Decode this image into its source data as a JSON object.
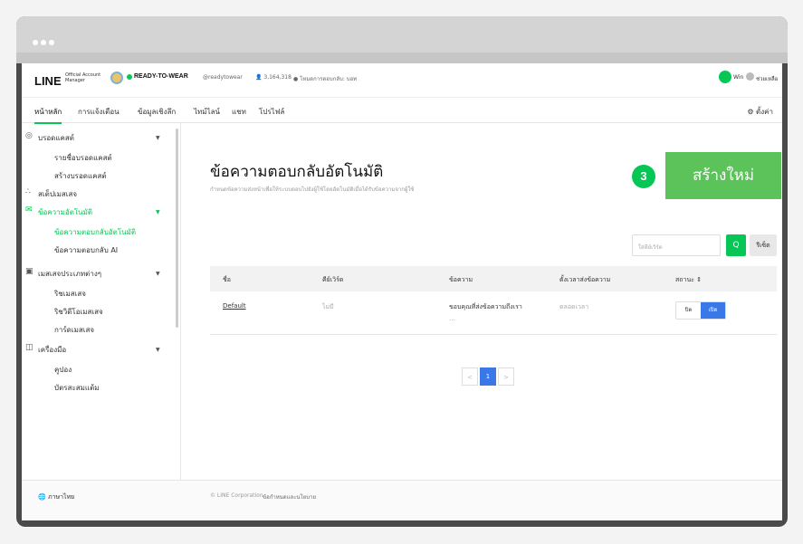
{
  "window": {
    "close_dot": "",
    "min_dot": "",
    "max_dot": ""
  },
  "header": {
    "logo": "LINE",
    "logo_sub": "Official Account Manager",
    "account_name": "READY-TO-WEAR",
    "account_id": "@readytowear",
    "friends": "3,164,318",
    "chat_mode": "โหมดการตอบกลับ: บอท",
    "status_label": "Win",
    "help_label": "ช่วยเหลือ"
  },
  "nav": {
    "tabs": [
      "หน้าหลัก",
      "การแจ้งเตือน",
      "ข้อมูลเชิงลึก",
      "ไทม์ไลน์",
      "แชท",
      "โปรไฟล์"
    ],
    "settings": "ตั้งค่า"
  },
  "sidebar": {
    "broadcast": "บรอดแคสต์",
    "broadcast_list": "รายชื่อบรอดแคสต์",
    "create_broadcast": "สร้างบรอดแคสต์",
    "sp_message": "สเต็ปเมสเสจ",
    "auto_reply": "ข้อความอัตโนมัติ",
    "auto_reply_msg": "ข้อความตอบกลับอัตโนมัติ",
    "auto_reply_ai": "ข้อความตอบกลับ AI",
    "message_types": "เมสเสจประเภทต่างๆ",
    "rich_message": "ริชเมสเสจ",
    "rich_video": "ริชวิดีโอเมสเสจ",
    "card_message": "การ์ดเมสเสจ",
    "tools": "เครื่องมือ",
    "coupon": "คูปอง",
    "reward_card": "บัตรสะสมแต้ม"
  },
  "content": {
    "title": "ข้อความตอบกลับอัตโนมัติ",
    "description": "กำหนดข้อความส่งหน้าเพื่อให้ระบบตอบไปยังผู้ใช้โดยอัตโนมัติเมื่อได้รับข้อความจากผู้ใช้",
    "step": "3",
    "create_button": "สร้างใหม่",
    "search_placeholder": "ใส่คีย์เวิร์ด",
    "search_icon": "Q",
    "reset": "รีเซ็ต"
  },
  "table": {
    "headers": [
      "ชื่อ",
      "คีย์เวิร์ด",
      "ข้อความ",
      "ตั้งเวลาส่งข้อความ",
      "สถานะ ⇕"
    ],
    "rows": [
      {
        "name": "Default",
        "keyword": "ไม่มี",
        "message": "ขอบคุณที่ส่งข้อความถึงเรา",
        "message_cont": "...",
        "schedule": "ตลอดเวลา",
        "off": "ปิด",
        "on": "เปิด"
      }
    ]
  },
  "pagination": {
    "prev": "<",
    "current": "1",
    "next": ">"
  },
  "footer": {
    "language": "ภาษาไทย",
    "copyright": "© LINE Corporation",
    "terms": "ข้อกำหนดและนโยบาย"
  }
}
